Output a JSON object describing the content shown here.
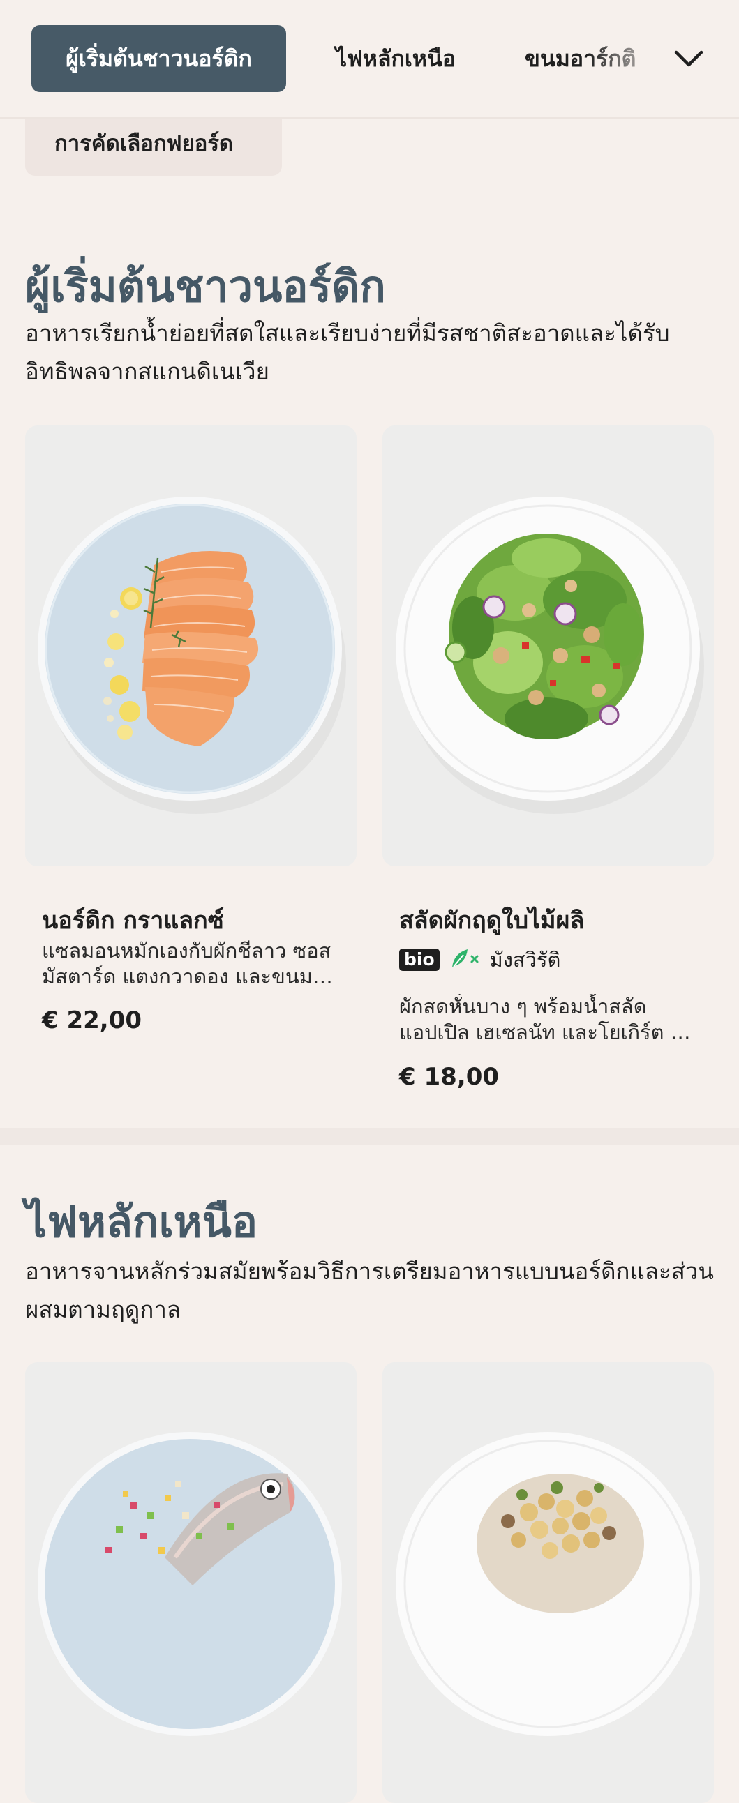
{
  "categories": {
    "items": [
      "ผู้เริ่มต้นชาวนอร์ดิก",
      "ไฟหลักเหนือ",
      "ขนมอาร์กติ"
    ],
    "active_index": 0,
    "filter_label": "การคัดเลือกฟยอร์ด"
  },
  "sections": [
    {
      "title": "ผู้เริ่มต้นชาวนอร์ดิก",
      "description": "อาหารเรียกน้ำย่อยที่สดใสและเรียบง่ายที่มีรสชาติสะอาดและได้รับอิทธิพลจากสแกนดิเนเวีย",
      "dishes": [
        {
          "name": "นอร์ดิก กราแลกซ์",
          "description_lines": [
            "แซลมอนหมักเองกับผักชีลาว ซอส",
            "มัสตาร์ด แตงกวาดอง และขนมปั..."
          ],
          "price": "€ 22,00",
          "image_icon": "salmon-dish-image"
        },
        {
          "name": "สลัดผักฤดูใบไม้ผลิ",
          "badges": {
            "bio": "bio",
            "vegan": "มังสวิรัติ"
          },
          "description_lines": [
            "ผักสดหั่นบาง ๆ พร้อมน้ำสลัด",
            "แอปเปิล เฮเซลนัท และโยเกิร์ต ว..."
          ],
          "price": "€ 18,00",
          "image_icon": "salad-dish-image"
        }
      ]
    },
    {
      "title": "ไฟหลักเหนือ",
      "description": "อาหารจานหลักร่วมสมัยพร้อมวิธีการเตรียมอาหารแบบนอร์ดิกและส่วนผสมตามฤดูกาล",
      "dishes": [
        {
          "image_icon": "fish-dish-image"
        },
        {
          "image_icon": "chickpea-dish-image"
        }
      ]
    }
  ],
  "colors": {
    "background": "#f6f0ec",
    "accent": "#475a67",
    "heading": "#455866",
    "vegan_green": "#2fb36a"
  }
}
